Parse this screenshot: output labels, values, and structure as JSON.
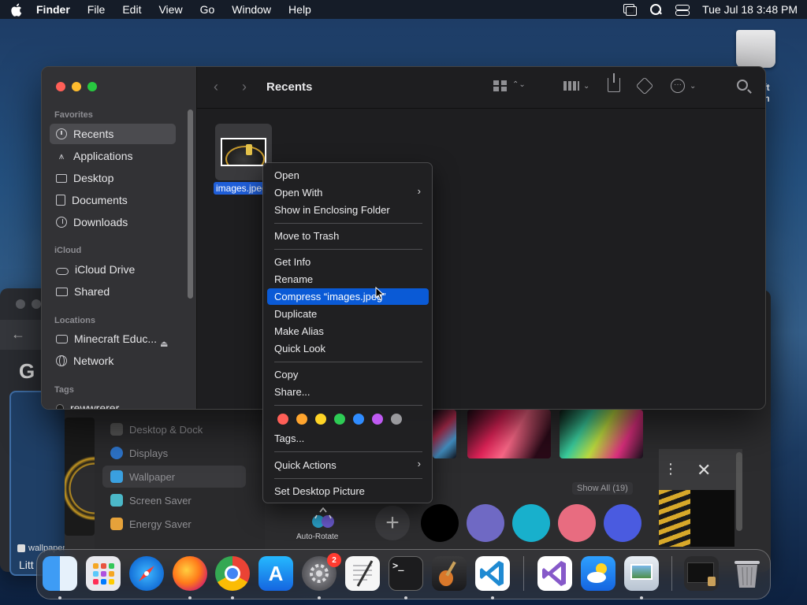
{
  "menubar": {
    "app_name": "Finder",
    "items": [
      "File",
      "Edit",
      "View",
      "Go",
      "Window",
      "Help"
    ],
    "clock": "Tue Jul 18  3:48 PM"
  },
  "desktop": {
    "disk_label": "aft\non"
  },
  "finder": {
    "title": "Recents",
    "sidebar": {
      "favorites_heading": "Favorites",
      "favorites": [
        "Recents",
        "Applications",
        "Desktop",
        "Documents",
        "Downloads"
      ],
      "icloud_heading": "iCloud",
      "icloud": [
        "iCloud Drive",
        "Shared"
      ],
      "locations_heading": "Locations",
      "locations": [
        "Minecraft Educ...",
        "Network"
      ],
      "tags_heading": "Tags",
      "tags": [
        "rewwrerer"
      ]
    },
    "file": {
      "name": "images.jpeg"
    }
  },
  "context_menu": {
    "items": {
      "open": "Open",
      "open_with": "Open With",
      "show_enclosing": "Show in Enclosing Folder",
      "trash": "Move to Trash",
      "get_info": "Get Info",
      "rename": "Rename",
      "compress": "Compress “images.jpeg”",
      "duplicate": "Duplicate",
      "make_alias": "Make Alias",
      "quick_look": "Quick Look",
      "copy": "Copy",
      "share": "Share...",
      "tags": "Tags...",
      "quick_actions": "Quick Actions",
      "set_desktop": "Set Desktop Picture"
    },
    "tag_colors": [
      "#ff5f57",
      "#ffa52e",
      "#ffd426",
      "#2ecc55",
      "#2f8cff",
      "#bf5af2",
      "#9a9a9e"
    ]
  },
  "settings": {
    "sidebar": [
      "Desktop & Dock",
      "Displays",
      "Wallpaper",
      "Screen Saver",
      "Energy Saver"
    ],
    "show_all": "Show All (19)",
    "auto_rotate": "Auto-Rotate"
  },
  "browser": {
    "g_letter": "G",
    "card_label": "wallpaper",
    "card_sub": "Litt"
  },
  "dock": {
    "apps": [
      "finder",
      "launchpad",
      "safari",
      "firefox",
      "chrome",
      "app-store",
      "system-settings",
      "textedit",
      "terminal",
      "garageband",
      "vscode",
      "visual-studio",
      "weather",
      "preview",
      "screenshot",
      "trash"
    ],
    "settings_badge": "2"
  }
}
